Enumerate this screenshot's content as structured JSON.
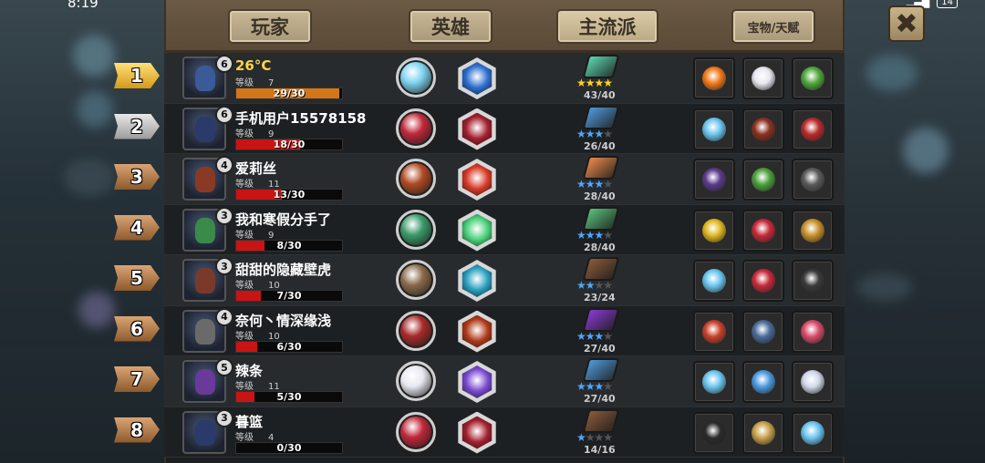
{
  "status_bar": {
    "time": "8:19",
    "battery": "14"
  },
  "tabs": [
    {
      "label": "玩家",
      "active": false
    },
    {
      "label": "英雄",
      "active": false
    },
    {
      "label": "主流派",
      "active": true
    },
    {
      "label": "宝物/天赋",
      "active": false
    }
  ],
  "close_label": "✖",
  "level_label": "等级",
  "players": [
    {
      "rank": "1",
      "rank_style": "gold",
      "name": "26°C",
      "name_gold": true,
      "hero_level": "6",
      "level": "7",
      "xp": "29/30",
      "xp_fraction": 0.97,
      "talent_score": "43/40",
      "stars_on": 4,
      "star_color": "gold",
      "colors": {
        "avatar": "#3a5a9a",
        "orb": "#7fd4f0",
        "hex": "#2d6fd0",
        "book": "#5bd6b0",
        "items": [
          "#f27a1a",
          "#e8e8f0",
          "#4fa83a"
        ]
      }
    },
    {
      "rank": "2",
      "rank_style": "silver",
      "name": "手机用户15578158",
      "name_gold": false,
      "hero_level": "6",
      "level": "9",
      "xp": "18/30",
      "xp_fraction": 0.6,
      "talent_score": "26/40",
      "stars_on": 3,
      "star_color": "blue",
      "colors": {
        "avatar": "#2a3a6a",
        "orb": "#c0283a",
        "hex": "#a3202e",
        "book": "#4f9ad8",
        "items": [
          "#6ac6f0",
          "#8a3020",
          "#b82a2a"
        ]
      }
    },
    {
      "rank": "3",
      "rank_style": "bronze",
      "name": "爱莉丝",
      "name_gold": false,
      "hero_level": "4",
      "level": "11",
      "xp": "13/30",
      "xp_fraction": 0.43,
      "talent_score": "28/40",
      "stars_on": 3,
      "star_color": "blue",
      "colors": {
        "avatar": "#8a3a24",
        "orb": "#b04a24",
        "hex": "#d83a28",
        "book": "#e88a4a",
        "items": [
          "#5a3a8a",
          "#4aa03a",
          "#5a5a5a"
        ]
      }
    },
    {
      "rank": "4",
      "rank_style": "bronze",
      "name": "我和寒假分手了",
      "name_gold": false,
      "hero_level": "3",
      "level": "9",
      "xp": "8/30",
      "xp_fraction": 0.27,
      "talent_score": "28/40",
      "stars_on": 3,
      "star_color": "blue",
      "colors": {
        "avatar": "#3a8a4a",
        "orb": "#3a9a6a",
        "hex": "#4ad07a",
        "book": "#5ac07a",
        "items": [
          "#e0b820",
          "#c8283a",
          "#c8902a"
        ]
      }
    },
    {
      "rank": "5",
      "rank_style": "bronze",
      "name": "甜甜的隐藏壁虎",
      "name_gold": false,
      "hero_level": "3",
      "level": "10",
      "xp": "7/30",
      "xp_fraction": 0.23,
      "talent_score": "23/24",
      "stars_on": 2,
      "star_color": "blue",
      "colors": {
        "avatar": "#7a3a2a",
        "orb": "#8a6a4a",
        "hex": "#2aa0c0",
        "book": "#8a5a3a",
        "items": [
          "#6ac6f0",
          "#c8283a",
          "#3a3a3a"
        ]
      }
    },
    {
      "rank": "6",
      "rank_style": "bronze",
      "name": "奈何丶情深缘浅",
      "name_gold": false,
      "hero_level": "4",
      "level": "10",
      "xp": "6/30",
      "xp_fraction": 0.2,
      "talent_score": "27/40",
      "stars_on": 3,
      "star_color": "blue",
      "colors": {
        "avatar": "#6a6a6a",
        "orb": "#a82a2a",
        "hex": "#b03a1a",
        "book": "#8a3ad0",
        "items": [
          "#c8402a",
          "#4a6a9a",
          "#d84a6a"
        ]
      }
    },
    {
      "rank": "7",
      "rank_style": "bronze",
      "name": "辣条",
      "name_gold": false,
      "hero_level": "5",
      "level": "11",
      "xp": "5/30",
      "xp_fraction": 0.17,
      "talent_score": "27/40",
      "stars_on": 3,
      "star_color": "blue",
      "colors": {
        "avatar": "#6a3a9a",
        "orb": "#e8e8f0",
        "hex": "#7a4ad0",
        "book": "#4f9ad8",
        "items": [
          "#6ac6f0",
          "#4a9ae0",
          "#d0d8e8"
        ]
      }
    },
    {
      "rank": "8",
      "rank_style": "bronze",
      "name": "暮篮",
      "name_gold": false,
      "hero_level": "3",
      "level": "4",
      "xp": "0/30",
      "xp_fraction": 0,
      "talent_score": "14/16",
      "stars_on": 1,
      "star_color": "blue",
      "colors": {
        "avatar": "#2a3a6a",
        "orb": "#c0283a",
        "hex": "#a3202e",
        "book": "#8a5a3a",
        "items": [
          "#2a2a2a",
          "#c8a04a",
          "#6ac6f0"
        ]
      }
    }
  ]
}
